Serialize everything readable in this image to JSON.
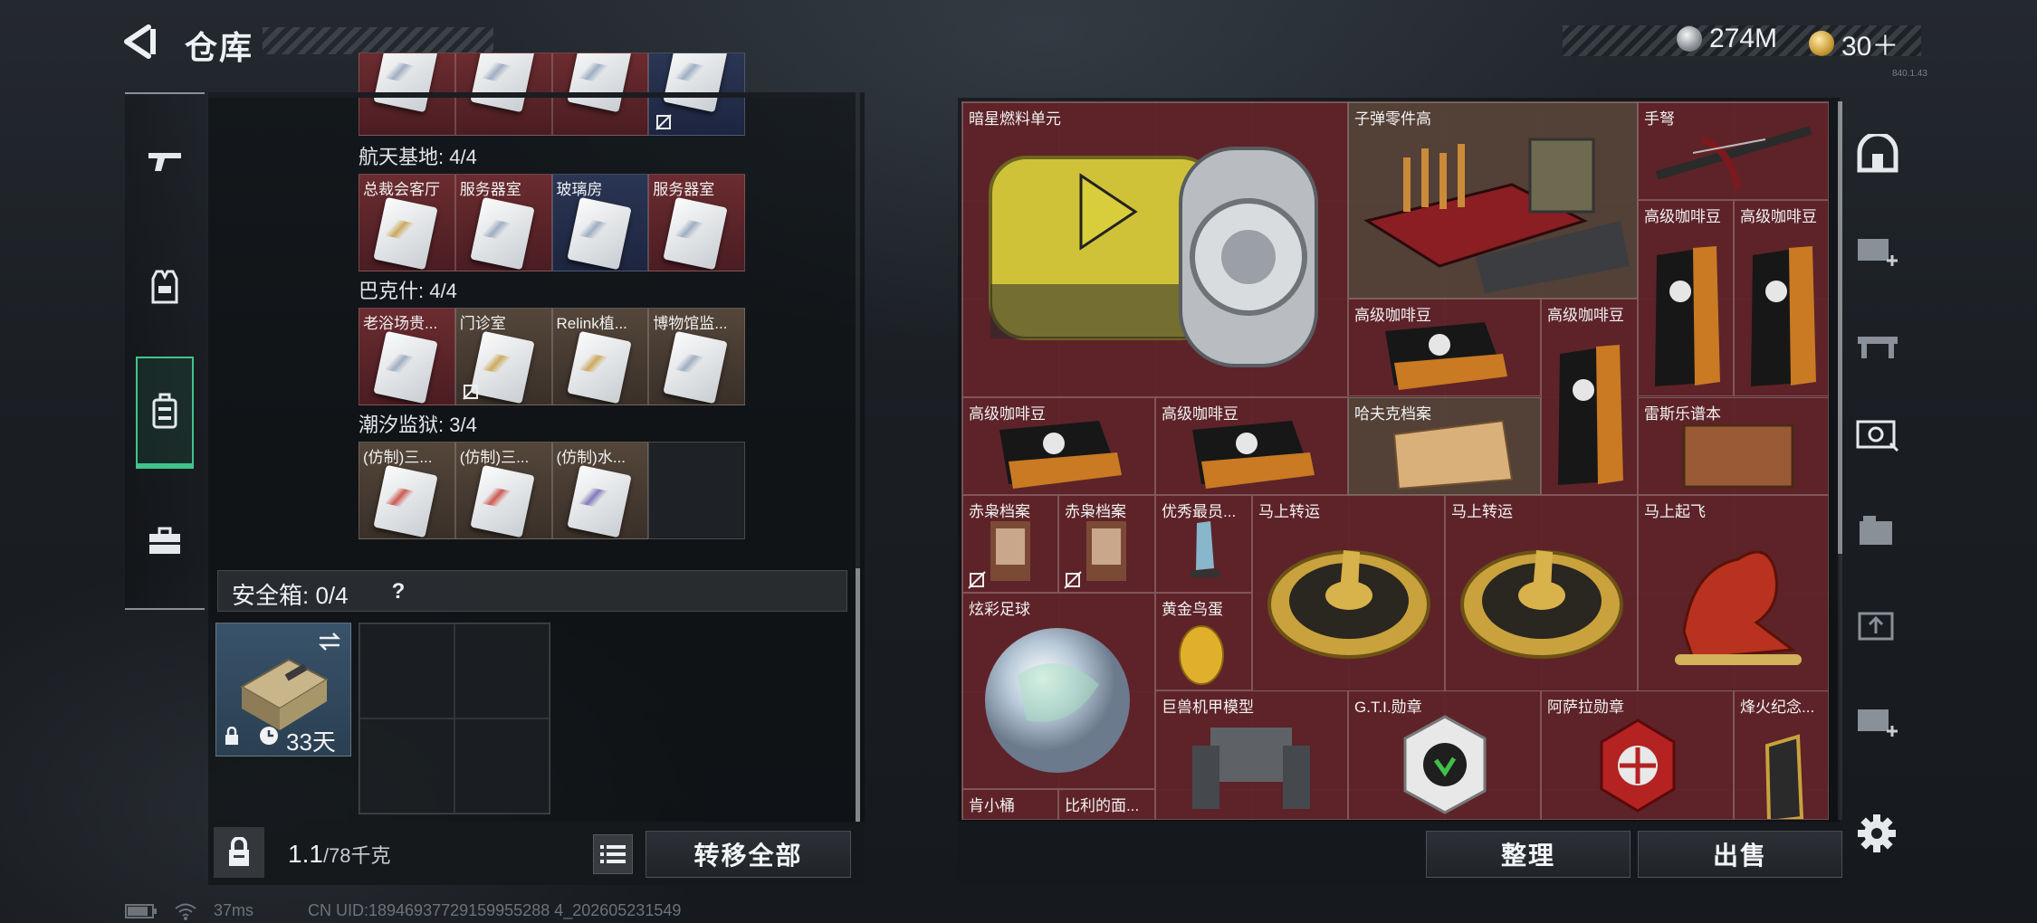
{
  "header": {
    "title": "仓库",
    "currency": [
      {
        "icon": "silver-coin-icon",
        "value": "274M"
      },
      {
        "icon": "gold-coin-icon",
        "value": "30＋"
      }
    ],
    "version": "840.1.43"
  },
  "left_tabs": [
    {
      "icon": "gun-icon",
      "active": false
    },
    {
      "icon": "armor-vest-icon",
      "active": false
    },
    {
      "icon": "backpack-icon",
      "active": true
    },
    {
      "icon": "toolbox-icon",
      "active": false
    }
  ],
  "key_sections": [
    {
      "title": "",
      "cards": [
        {
          "name": "",
          "bg": "red"
        },
        {
          "name": "",
          "bg": "red"
        },
        {
          "name": "",
          "bg": "red"
        },
        {
          "name": "",
          "bg": "blue",
          "nosell": true
        }
      ]
    },
    {
      "title": "航天基地: 4/4",
      "cards": [
        {
          "name": "总裁会客厅",
          "bg": "red",
          "style": "gold"
        },
        {
          "name": "服务器室",
          "bg": "red"
        },
        {
          "name": "玻璃房",
          "bg": "blue"
        },
        {
          "name": "服务器室",
          "bg": "red"
        }
      ]
    },
    {
      "title": "巴克什: 4/4",
      "cards": [
        {
          "name": "老浴场贵...",
          "bg": "red"
        },
        {
          "name": "门诊室",
          "bg": "brown",
          "nosell": true
        },
        {
          "name": "Relink植...",
          "bg": "brown"
        },
        {
          "name": "博物馆监...",
          "bg": "brown"
        }
      ]
    },
    {
      "title": "潮汐监狱: 3/4",
      "cards": [
        {
          "name": "(仿制)三...",
          "bg": "brown",
          "style": "redline"
        },
        {
          "name": "(仿制)三...",
          "bg": "brown",
          "style": "redline"
        },
        {
          "name": "(仿制)水...",
          "bg": "brown",
          "style": "purple"
        },
        {
          "name": "",
          "bg": "empty"
        }
      ]
    }
  ],
  "safebox": {
    "title": "安全箱: 0/4",
    "help": "?",
    "days": "33天"
  },
  "left_footer": {
    "weight": "1.1",
    "weight_unit": "/78千克",
    "transfer_all": "转移全部"
  },
  "stash_items": [
    {
      "name": "暗星燃料单元",
      "bg": "red",
      "icon": "fuel-canister-icon"
    },
    {
      "name": "子弹零件高",
      "bg": "brown",
      "icon": "ammo-crate-icon"
    },
    {
      "name": "手弩",
      "bg": "red",
      "icon": "crossbow-icon"
    },
    {
      "name": "高级咖啡豆",
      "bg": "red",
      "icon": "coffee-bag-icon"
    },
    {
      "name": "高级咖啡豆",
      "bg": "red",
      "icon": "coffee-bag-icon"
    },
    {
      "name": "高级咖啡豆",
      "bg": "red",
      "icon": "coffee-bag-icon"
    },
    {
      "name": "高级咖啡豆",
      "bg": "red",
      "icon": "coffee-bag-icon"
    },
    {
      "name": "高级咖啡豆",
      "bg": "red",
      "icon": "coffee-bag-icon"
    },
    {
      "name": "高级咖啡豆",
      "bg": "red",
      "icon": "coffee-bag-icon"
    },
    {
      "name": "哈夫克档案",
      "bg": "red",
      "icon": "document-folder-icon"
    },
    {
      "name": "雷斯乐谱本",
      "bg": "red",
      "icon": "music-book-icon"
    },
    {
      "name": "赤枭档案",
      "bg": "red",
      "icon": "file-icon"
    },
    {
      "name": "赤枭档案",
      "bg": "red",
      "icon": "file-icon"
    },
    {
      "name": "优秀最员...",
      "bg": "red",
      "icon": "crystal-trophy-icon"
    },
    {
      "name": "马上转运",
      "bg": "red",
      "icon": "golden-wheel-icon"
    },
    {
      "name": "马上转运",
      "bg": "red",
      "icon": "golden-wheel-icon"
    },
    {
      "name": "马上起飞",
      "bg": "red",
      "icon": "red-horse-statue-icon"
    },
    {
      "name": "炫彩足球",
      "bg": "red",
      "icon": "iridescent-ball-icon"
    },
    {
      "name": "黄金鸟蛋",
      "bg": "red",
      "icon": "golden-egg-icon"
    },
    {
      "name": "巨兽机甲模型",
      "bg": "red",
      "icon": "mech-model-icon"
    },
    {
      "name": "G.T.I.勋章",
      "bg": "red",
      "icon": "gti-medal-icon"
    },
    {
      "name": "阿萨拉勋章",
      "bg": "red",
      "icon": "asala-medal-icon"
    },
    {
      "name": "烽火纪念...",
      "bg": "red",
      "icon": "memorial-trophy-icon"
    },
    {
      "name": "肯小桶",
      "bg": "red",
      "icon": "bucket-icon"
    },
    {
      "name": "比利的面...",
      "bg": "red",
      "icon": "mask-icon"
    }
  ],
  "right_footer": {
    "organize": "整理",
    "sell": "出售"
  },
  "right_rail": [
    "bunker-icon",
    "add-storage-icon",
    "workbench-icon",
    "safe-vault-icon",
    "folder-stack-icon",
    "upload-box-icon",
    "add-container-icon",
    "gear-icon"
  ],
  "status": {
    "ping": "37ms",
    "uid": "CN UID:18946937729159955288 4_202605231549"
  }
}
